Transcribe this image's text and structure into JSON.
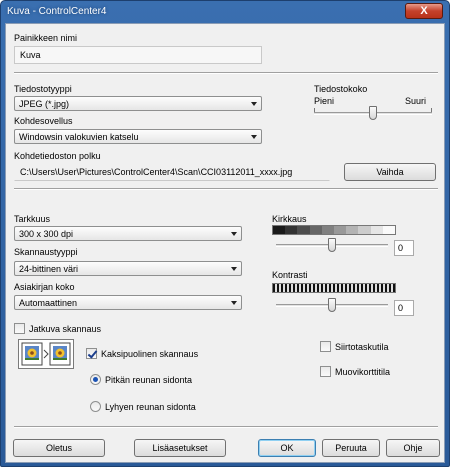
{
  "window": {
    "title": "Kuva - ControlCenter4",
    "close_label": "X"
  },
  "button_name": {
    "label": "Painikkeen nimi",
    "value": "Kuva"
  },
  "file_type": {
    "label": "Tiedostotyyppi",
    "value": "JPEG (*.jpg)"
  },
  "file_size": {
    "label": "Tiedostokoko",
    "min_label": "Pieni",
    "max_label": "Suuri",
    "level": 0.5
  },
  "target_app": {
    "label": "Kohdesovellus",
    "value": "Windowsin valokuvien katselu"
  },
  "target_path": {
    "label": "Kohdetiedoston polku",
    "value": "C:\\Users\\User\\Pictures\\ControlCenter4\\Scan\\CCI03112011_xxxx.jpg",
    "change_label": "Vaihda"
  },
  "resolution": {
    "label": "Tarkkuus",
    "value": "300 x 300 dpi"
  },
  "scan_type": {
    "label": "Skannaustyyppi",
    "value": "24-bittinen väri"
  },
  "document_size": {
    "label": "Asiakirjan koko",
    "value": "Automaattinen"
  },
  "brightness": {
    "label": "Kirkkaus",
    "value": "0",
    "level": 0.5
  },
  "contrast": {
    "label": "Kontrasti",
    "value": "0",
    "level": 0.5
  },
  "options": {
    "continuous_scan": {
      "label": "Jatkuva skannaus",
      "checked": false
    },
    "duplex_scan": {
      "label": "Kaksipuolinen skannaus",
      "checked": true
    },
    "long_edge": {
      "label": "Pitkän reunan sidonta",
      "selected": true
    },
    "short_edge": {
      "label": "Lyhyen reunan sidonta",
      "selected": false
    },
    "carrier_sheet": {
      "label": "Siirtotaskutila",
      "checked": false
    },
    "plastic_card": {
      "label": "Muovikorttitila",
      "checked": false
    }
  },
  "footer": {
    "default_label": "Oletus",
    "advanced_label": "Lisäasetukset",
    "ok_label": "OK",
    "cancel_label": "Peruuta",
    "help_label": "Ohje"
  },
  "colors": {
    "title_bar": "#3a6fb0",
    "close_button": "#c4412b",
    "dialog_bg": "#f0f0f0",
    "accent": "#1b53b4"
  },
  "icons": [
    "close-icon",
    "dropdown-arrow-icon",
    "duplex-page-icon",
    "checkbox-icon",
    "radio-icon"
  ]
}
